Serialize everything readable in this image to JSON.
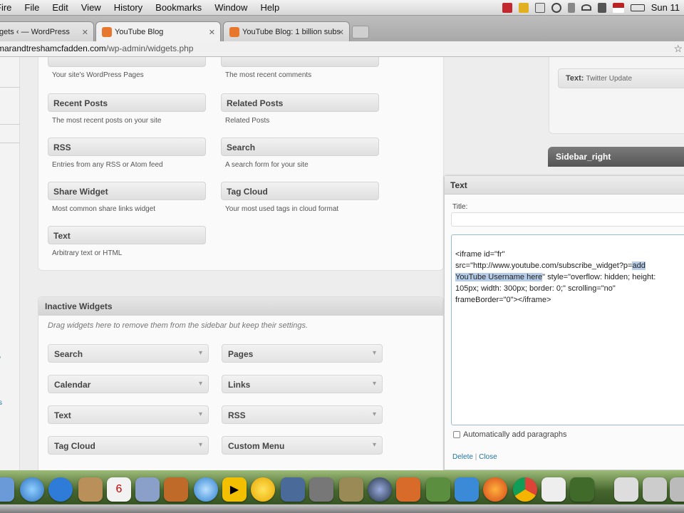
{
  "menubar": {
    "items": [
      "Fire",
      "File",
      "Edit",
      "View",
      "History",
      "Bookmarks",
      "Window",
      "Help"
    ],
    "clock": "Sun 11"
  },
  "tabs": [
    {
      "label": "gets ‹ — WordPress",
      "favicon_color": "#5b8bbf"
    },
    {
      "label": "YouTube Blog",
      "favicon_color": "#e8772e"
    },
    {
      "label": "YouTube Blog: 1 billion subs",
      "favicon_color": "#e8772e"
    }
  ],
  "address": {
    "host": "marandtreshamcfadden.com",
    "path": "/wp-admin/widgets.php"
  },
  "available_widgets": {
    "top_left_desc": "Your site's WordPress Pages",
    "top_right_desc": "The most recent comments",
    "items": [
      {
        "name": "Recent Posts",
        "desc": "The most recent posts on your site"
      },
      {
        "name": "Related Posts",
        "desc": "Related Posts"
      },
      {
        "name": "RSS",
        "desc": "Entries from any RSS or Atom feed"
      },
      {
        "name": "Search",
        "desc": "A search form for your site"
      },
      {
        "name": "Share Widget",
        "desc": "Most common share links widget"
      },
      {
        "name": "Tag Cloud",
        "desc": "Your most used tags in cloud format"
      },
      {
        "name": "Text",
        "desc": "Arbitrary text or HTML"
      }
    ]
  },
  "inactive": {
    "title": "Inactive Widgets",
    "desc": "Drag widgets here to remove them from the sidebar but keep their settings.",
    "widgets": [
      "Search",
      "Pages",
      "Calendar",
      "Links",
      "Text",
      "RSS",
      "Tag Cloud",
      "Custom Menu"
    ]
  },
  "sidebar": {
    "twitter_label": "Text:",
    "twitter_title": "Twitter Update",
    "sidebar_right": "Sidebar_right"
  },
  "text_widget": {
    "header": "Text",
    "title_label": "Title:",
    "title_value": "",
    "content_pre": "<iframe id=\"fr\"\nsrc=\"http://www.youtube.com/subscribe_widget?p=",
    "content_sel": "add\nYouTube Username here",
    "content_post": "\" style=\"overflow: hidden; height:\n105px; width: 300px; border: 0;\" scrolling=\"no\"\nframeBorder=\"0\"></iframe>",
    "autop_label": "Automatically add paragraphs",
    "delete": "Delete",
    "close": "Close"
  }
}
